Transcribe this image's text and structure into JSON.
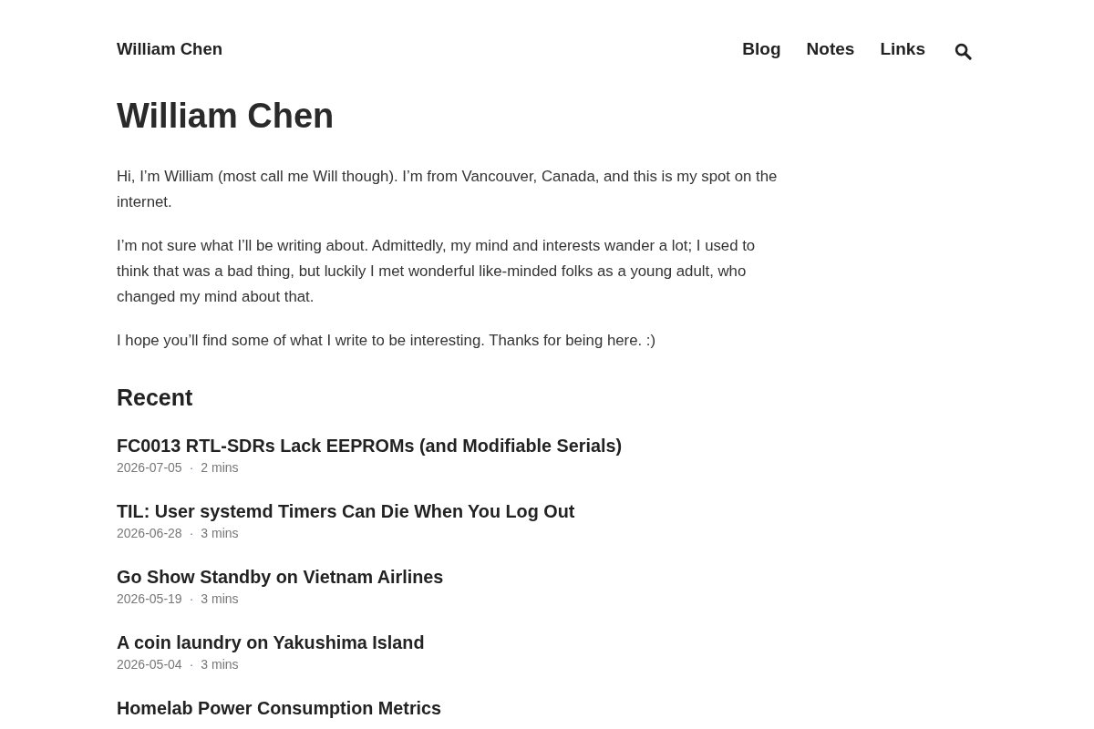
{
  "header": {
    "site_title": "William Chen",
    "nav": [
      {
        "label": "Blog"
      },
      {
        "label": "Notes"
      },
      {
        "label": "Links"
      }
    ]
  },
  "page": {
    "title": "William Chen",
    "paragraphs": [
      "Hi, I’m William (most call me Will though). I’m from Vancouver, Canada, and this is my spot on the internet.",
      "I’m not sure what I’ll be writing about. Admittedly, my mind and interests wander a lot; I used to think that was a bad thing, but luckily I met wonderful like-minded folks as a young adult, who changed my mind about that.",
      "I hope you’ll find some of what I write to be interesting. Thanks for being here. :)"
    ]
  },
  "recent": {
    "heading": "Recent",
    "posts": [
      {
        "title": "FC0013 RTL-SDRs Lack EEPROMs (and Modifiable Serials)",
        "date": "2026-07-05",
        "separator": "·",
        "read_time": "2 mins"
      },
      {
        "title": "TIL: User systemd Timers Can Die When You Log Out",
        "date": "2026-06-28",
        "separator": "·",
        "read_time": "3 mins"
      },
      {
        "title": "Go Show Standby on Vietnam Airlines",
        "date": "2026-05-19",
        "separator": "·",
        "read_time": "3 mins"
      },
      {
        "title": "A coin laundry on Yakushima Island",
        "date": "2026-05-04",
        "separator": "·",
        "read_time": "3 mins"
      },
      {
        "title": "Homelab Power Consumption Metrics"
      }
    ]
  }
}
